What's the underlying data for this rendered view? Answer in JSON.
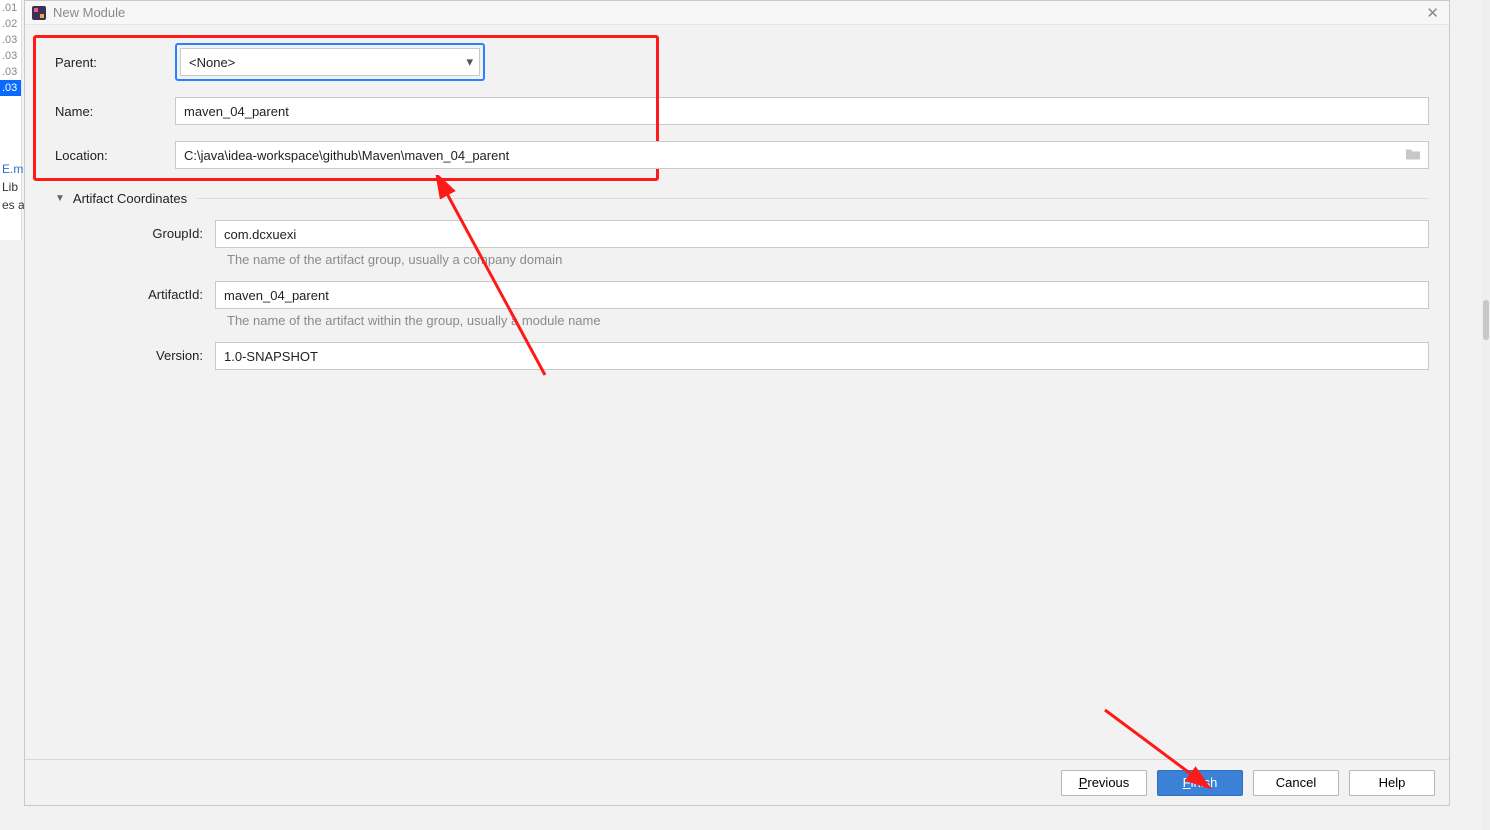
{
  "background": {
    "lines": [
      "01",
      "02",
      "03",
      "03",
      "03",
      "03"
    ],
    "selectedIndex": 5,
    "link": "E.m",
    "rows": [
      "Lib",
      "es a"
    ]
  },
  "dialog": {
    "title": "New Module",
    "labels": {
      "parent": "Parent:",
      "name": "Name:",
      "location": "Location:"
    },
    "parent_value": "<None>",
    "name_value": "maven_04_parent",
    "location_value": "C:\\java\\idea-workspace\\github\\Maven\\maven_04_parent",
    "section_title": "Artifact Coordinates",
    "artifact": {
      "group_label": "GroupId:",
      "group_value": "com.dcxuexi",
      "group_help": "The name of the artifact group, usually a company domain",
      "artifact_label": "ArtifactId:",
      "artifact_value": "maven_04_parent",
      "artifact_help": "The name of the artifact within the group, usually a module name",
      "version_label": "Version:",
      "version_value": "1.0-SNAPSHOT"
    },
    "buttons": {
      "previous_u": "P",
      "previous_rest": "revious",
      "finish_u": "F",
      "finish_rest": "inish",
      "cancel": "Cancel",
      "help": "Help"
    }
  }
}
